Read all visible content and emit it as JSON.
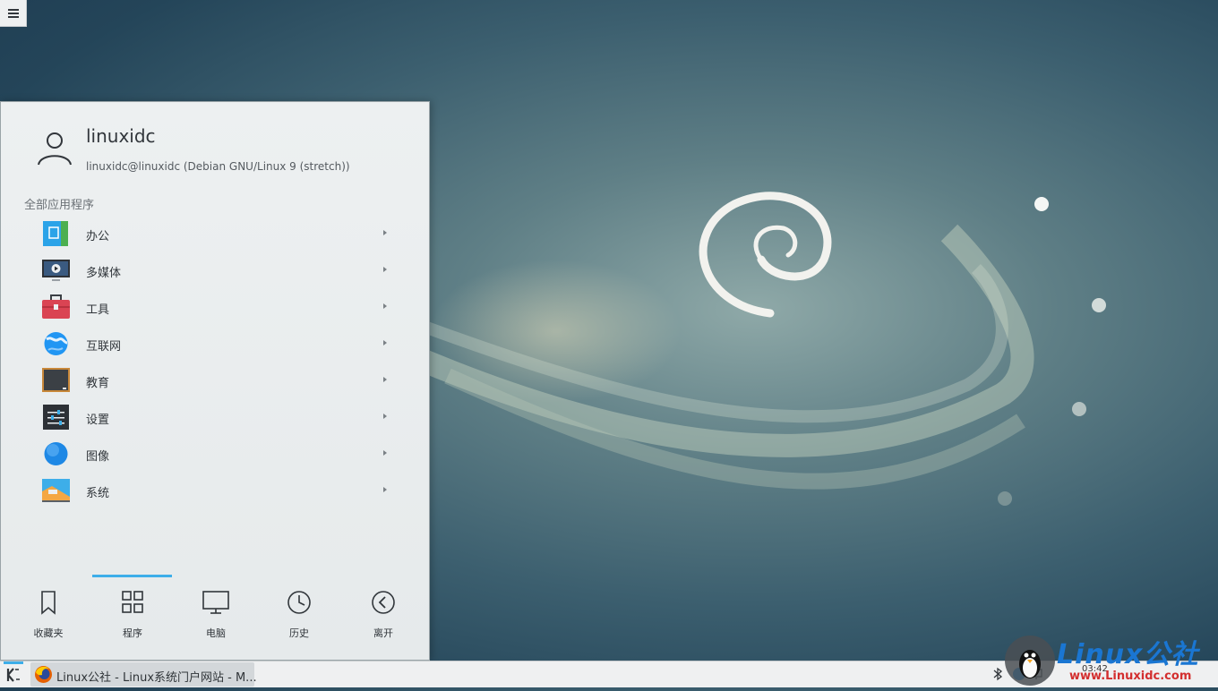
{
  "user": {
    "name": "linuxidc",
    "host": "linuxidc@linuxidc (Debian GNU/Linux 9 (stretch))"
  },
  "section_label": "全部应用程序",
  "apps": [
    {
      "label": "办公",
      "icon": "office-icon"
    },
    {
      "label": "多媒体",
      "icon": "multimedia-icon"
    },
    {
      "label": "工具",
      "icon": "utilities-icon"
    },
    {
      "label": "互联网",
      "icon": "internet-icon"
    },
    {
      "label": "教育",
      "icon": "education-icon"
    },
    {
      "label": "设置",
      "icon": "settings-icon"
    },
    {
      "label": "图像",
      "icon": "graphics-icon"
    },
    {
      "label": "系统",
      "icon": "system-icon"
    }
  ],
  "tabs": [
    {
      "label": "收藏夹",
      "icon": "bookmark-icon"
    },
    {
      "label": "程序",
      "icon": "grid-icon",
      "active": true
    },
    {
      "label": "电脑",
      "icon": "computer-icon"
    },
    {
      "label": "历史",
      "icon": "clock-icon"
    },
    {
      "label": "离开",
      "icon": "back-icon"
    }
  ],
  "taskbar": {
    "task_label": "Linux公社 - Linux系统门户网站 - M...",
    "task_icon": "firefox-icon"
  },
  "watermark": {
    "title": "Linux公社",
    "url": "www.Linuxidc.com",
    "clock": "03:42"
  },
  "colors": {
    "accent": "#3daee9",
    "panel": "#eff0f1"
  }
}
